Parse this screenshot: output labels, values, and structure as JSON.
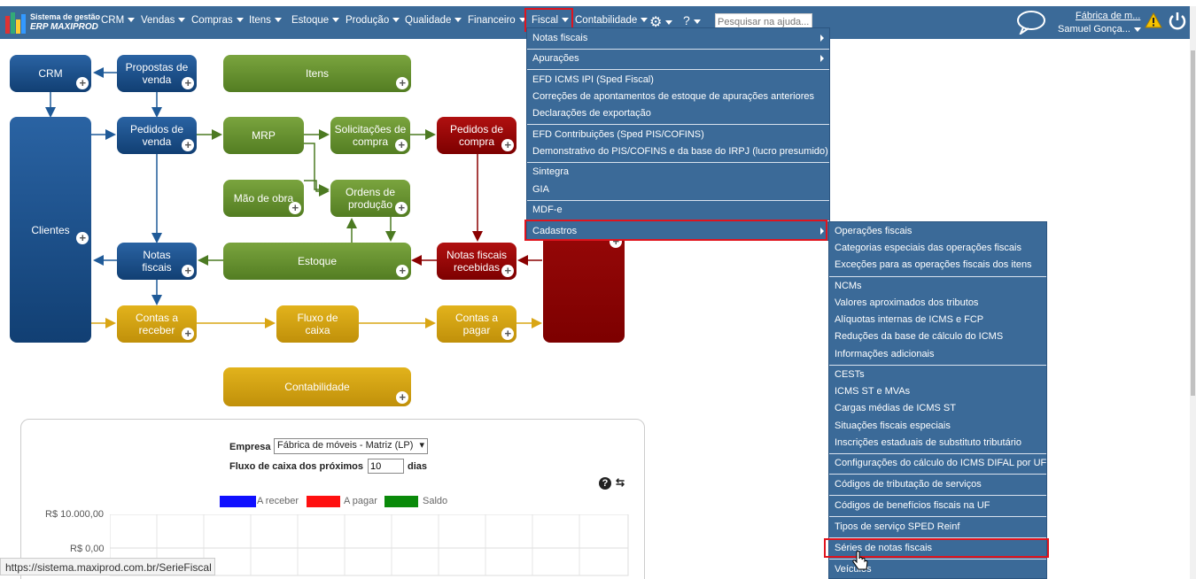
{
  "logo": {
    "line1": "Sistema de gestão",
    "line2": "ERP MAXIPROD"
  },
  "menu": [
    {
      "label": "CRM",
      "name": "menu-crm"
    },
    {
      "label": "Vendas",
      "name": "menu-vendas"
    },
    {
      "label": "Compras",
      "name": "menu-compras"
    },
    {
      "label": "Itens",
      "name": "menu-itens"
    },
    {
      "label": "Estoque",
      "name": "menu-estoque"
    },
    {
      "label": "Produção",
      "name": "menu-producao"
    },
    {
      "label": "Qualidade",
      "name": "menu-qualidade"
    },
    {
      "label": "Financeiro",
      "name": "menu-financeiro"
    },
    {
      "label": "Fiscal",
      "name": "menu-fiscal"
    },
    {
      "label": "Contabilidade",
      "name": "menu-contabilidade"
    }
  ],
  "search": {
    "placeholder": "Pesquisar na ajuda..."
  },
  "header": {
    "company": "Fábrica de m...",
    "user": "Samuel Gonça..."
  },
  "fiscal_menu": [
    "Notas fiscais",
    "Apurações",
    "EFD ICMS IPI (Sped Fiscal)",
    "Correções de apontamentos de estoque de apurações anteriores",
    "Declarações de exportação",
    "EFD Contribuições (Sped PIS/COFINS)",
    "Demonstrativo do PIS/COFINS e da base do IRPJ (lucro presumido)",
    "Sintegra",
    "GIA",
    "MDF-e",
    "Cadastros"
  ],
  "cadastros_menu": [
    "Operações fiscais",
    "Categorias especiais das operações fiscais",
    "Exceções para as operações fiscais dos itens",
    "NCMs",
    "Valores aproximados dos tributos",
    "Alíquotas internas de ICMS e FCP",
    "Reduções da base de cálculo do ICMS",
    "Informações adicionais",
    "CESTs",
    "ICMS ST e MVAs",
    "Cargas médias de ICMS ST",
    "Situações fiscais especiais",
    "Inscrições estaduais de substituto tributário",
    "Configurações do cálculo do ICMS DIFAL por UF",
    "Códigos de tributação de serviços",
    "Códigos de benefícios fiscais na UF",
    "Tipos de serviço SPED Reinf",
    "Séries de notas fiscais",
    "Veículos"
  ],
  "flow_nodes": {
    "crm": "CRM",
    "propostas": "Propostas de venda",
    "itens": "Itens",
    "clientes": "Clientes",
    "pedidos_venda": "Pedidos de venda",
    "mrp": "MRP",
    "solicitacoes": "Solicitações de compra",
    "pedidos_compra": "Pedidos de compra",
    "mao_obra": "Mão de obra",
    "ordens": "Ordens de produção",
    "notas": "Notas fiscais",
    "estoque": "Estoque",
    "notas_recebidas": "Notas fiscais recebidas",
    "contas_receber": "Contas a receber",
    "fluxo": "Fluxo de caixa",
    "contas_pagar": "Contas a pagar",
    "contabilidade": "Contabilidade"
  },
  "cashflow": {
    "empresa_label": "Empresa",
    "empresa_value": "Fábrica de móveis - Matriz (LP)",
    "dias_label": "Fluxo de caixa dos próximos",
    "dias_value": "10",
    "dias_suffix": "dias",
    "legend": [
      {
        "label": "A receber",
        "color": "#1010ff"
      },
      {
        "label": "A pagar",
        "color": "#ff1010"
      },
      {
        "label": "Saldo",
        "color": "#0a8a0a"
      }
    ],
    "y_ticks": [
      "R$ 10.000,00",
      "R$ 0,00"
    ]
  },
  "status_url": "https://sistema.maxiprod.com.br/SerieFiscal",
  "colors": {
    "topbar": "#3b6a98",
    "highlight": "#e0141e"
  }
}
